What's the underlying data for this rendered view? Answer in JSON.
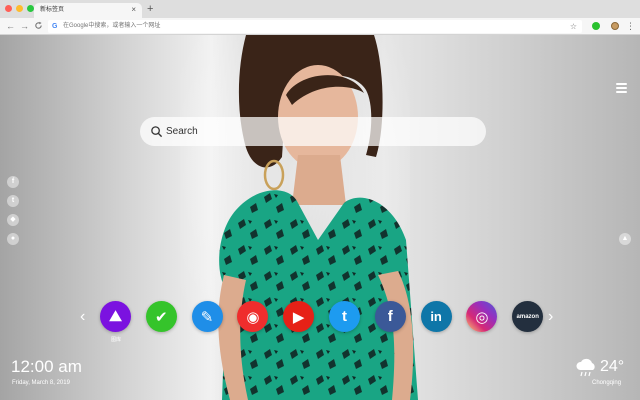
{
  "browser": {
    "tab_title": "新标签页",
    "tab_close": "×",
    "new_tab": "+",
    "back": "←",
    "forward": "→",
    "reload": "C",
    "omnibox_icon": "G",
    "omnibox_placeholder": "在Google中搜索，或者输入一个网址",
    "bookmark_star": "☆",
    "menu": "⋮",
    "traffic_lights": [
      "#ff5f57",
      "#febc2e",
      "#28c840"
    ]
  },
  "search": {
    "placeholder": "Search"
  },
  "social_icons": [
    "facebook-icon",
    "twitter-icon",
    "snapchat-icon",
    "wechat-icon"
  ],
  "apps": [
    {
      "name": "gallery",
      "label": "图库",
      "color": "#7b12e0",
      "glyph": "⛰"
    },
    {
      "name": "tasks",
      "label": "",
      "color": "#35c42b",
      "glyph": "✔"
    },
    {
      "name": "notes",
      "label": "",
      "color": "#1f8ee8",
      "glyph": "✎"
    },
    {
      "name": "games",
      "label": "",
      "color": "#ef2d2d",
      "glyph": "◉"
    },
    {
      "name": "youtube",
      "label": "",
      "color": "#e62117",
      "glyph": "▶"
    },
    {
      "name": "twitter",
      "label": "",
      "color": "#1d9bf0",
      "glyph": "t"
    },
    {
      "name": "facebook",
      "label": "",
      "color": "#3b5998",
      "glyph": "f"
    },
    {
      "name": "linkedin",
      "label": "",
      "color": "#0e76a8",
      "glyph": "in"
    },
    {
      "name": "instagram",
      "label": "",
      "color": "#d62976",
      "glyph": "◎"
    },
    {
      "name": "amazon",
      "label": "",
      "color": "#232f3e",
      "glyph": "amazon"
    }
  ],
  "nav": {
    "prev": "‹",
    "next": "›"
  },
  "clock": {
    "time": "12:00 am",
    "date": "Friday, March 8, 2019"
  },
  "weather": {
    "temp": "24°",
    "city": "Chongqing",
    "icon": "cloud-rain-icon"
  }
}
